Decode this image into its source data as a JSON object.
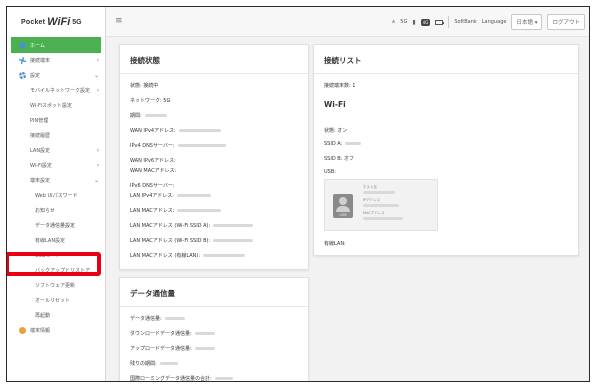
{
  "logo": {
    "part1": "Pocket",
    "part2": "WiFi",
    "part3": "5G"
  },
  "sidebar": {
    "items": [
      {
        "label": "ホーム"
      },
      {
        "label": "接続端末"
      },
      {
        "label": "設定"
      },
      {
        "label": "モバイルネットワーク設定"
      },
      {
        "label": "Wi-Fiスポット設定"
      },
      {
        "label": "PIN管理"
      },
      {
        "label": "接続履歴"
      },
      {
        "label": "LAN設定"
      },
      {
        "label": "Wi-Fi設定"
      },
      {
        "label": "端末設定"
      },
      {
        "label": "Web UIパスワード"
      },
      {
        "label": "お知らせ"
      },
      {
        "label": "データ通信量設定"
      },
      {
        "label": "有線LAN設定"
      },
      {
        "label": "USBモード"
      },
      {
        "label": "バックアップとリストア"
      },
      {
        "label": "ソフトウェア更新"
      },
      {
        "label": "オールリセット"
      },
      {
        "label": "再起動"
      },
      {
        "label": "端末情報"
      }
    ]
  },
  "topbar": {
    "signal_text": "5G",
    "lte_badge": "4G",
    "carrier": "SoftBank",
    "language_label": "Language",
    "language_value": "日本語",
    "logout_label": "ログアウト"
  },
  "connection_status": {
    "title": "接続状態",
    "rows": [
      {
        "label": "状態: 接続中"
      },
      {
        "label": "ネットワーク: 5G"
      },
      {
        "label": "期間:"
      },
      {
        "label": "WAN IPv4アドレス:"
      },
      {
        "label": "IPv4 DNSサーバー:"
      },
      {
        "label": "WAN IPv6アドレス:"
      },
      {
        "label": "WAN MACアドレス:"
      },
      {
        "label": "IPv6 DNSサーバー:"
      },
      {
        "label": "LAN IPv4アドレス:"
      },
      {
        "label": "LAN MACアドレス:"
      },
      {
        "label": "LAN MACアドレス (Wi-Fi SSID A):"
      },
      {
        "label": "LAN MACアドレス (Wi-Fi SSID B):"
      },
      {
        "label": "LAN MACアドレス (有線LAN):"
      }
    ]
  },
  "connection_list": {
    "title": "接続リスト",
    "count_label": "接続端末数: 1"
  },
  "wifi": {
    "title": "Wi-Fi",
    "state_label": "状態: オン",
    "ssid_a_label": "SSID A:",
    "ssid_b_label": "SSID B: オフ",
    "usb_label": "USB:",
    "usb_card": {
      "icon_label": "USB",
      "line1": "ホスト名",
      "line2": "IPアドレス",
      "line3": "MACアドレス"
    },
    "wired_label": "有線LAN:"
  },
  "data_usage": {
    "title": "データ通信量",
    "rows": [
      {
        "label": "データ通信量:"
      },
      {
        "label": "ダウンロードデータ通信量:"
      },
      {
        "label": "アップロードデータ通信量:"
      },
      {
        "label": "残りの期間:"
      },
      {
        "label": "国際ローミングデータ通信量の合計:"
      }
    ]
  },
  "colors": {
    "active_nav": "#4caf50",
    "highlight_box": "#e60012"
  }
}
